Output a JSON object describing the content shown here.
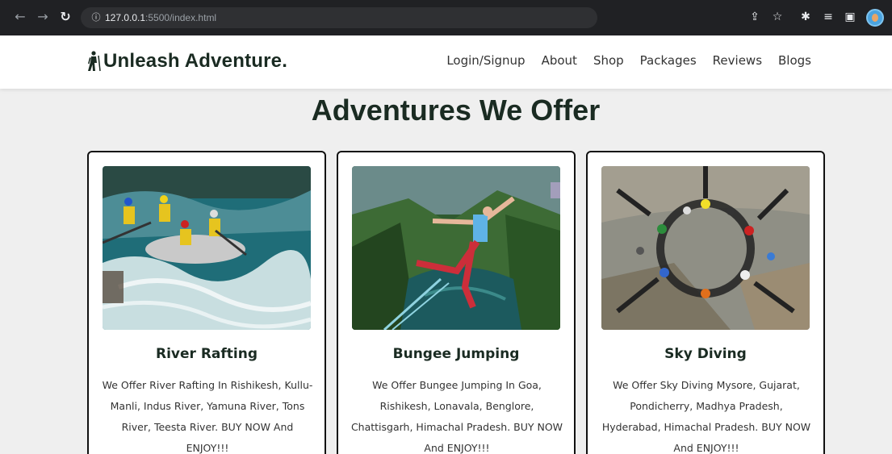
{
  "browser": {
    "url_host": "127.0.0.1",
    "url_rest": ":5500/index.html",
    "back_icon": "arrow-left-icon",
    "forward_icon": "arrow-right-icon",
    "reload_icon": "reload-icon"
  },
  "header": {
    "brand": "Unleash Adventure.",
    "nav": [
      "Login/Signup",
      "About",
      "Shop",
      "Packages",
      "Reviews",
      "Blogs"
    ]
  },
  "main": {
    "title": "Adventures We Offer",
    "cards": [
      {
        "title": "River Rafting",
        "description": "We Offer River Rafting In Rishikesh, Kullu-Manli, Indus River, Yamuna River, Tons River, Teesta River. BUY NOW And ENJOY!!!"
      },
      {
        "title": "Bungee Jumping",
        "description": "We Offer Bungee Jumping In Goa, Rishikesh, Lonavala, Benglore, Chattisgarh, Himachal Pradesh. BUY NOW And ENJOY!!!"
      },
      {
        "title": "Sky Diving",
        "description": "We Offer Sky Diving Mysore, Gujarat, Pondicherry, Madhya Pradesh, Hyderabad, Himachal Pradesh. BUY NOW And ENJOY!!!"
      }
    ]
  },
  "colors": {
    "brand_text": "#1a2b22",
    "page_bg": "#efefef",
    "card_border": "#111111"
  }
}
